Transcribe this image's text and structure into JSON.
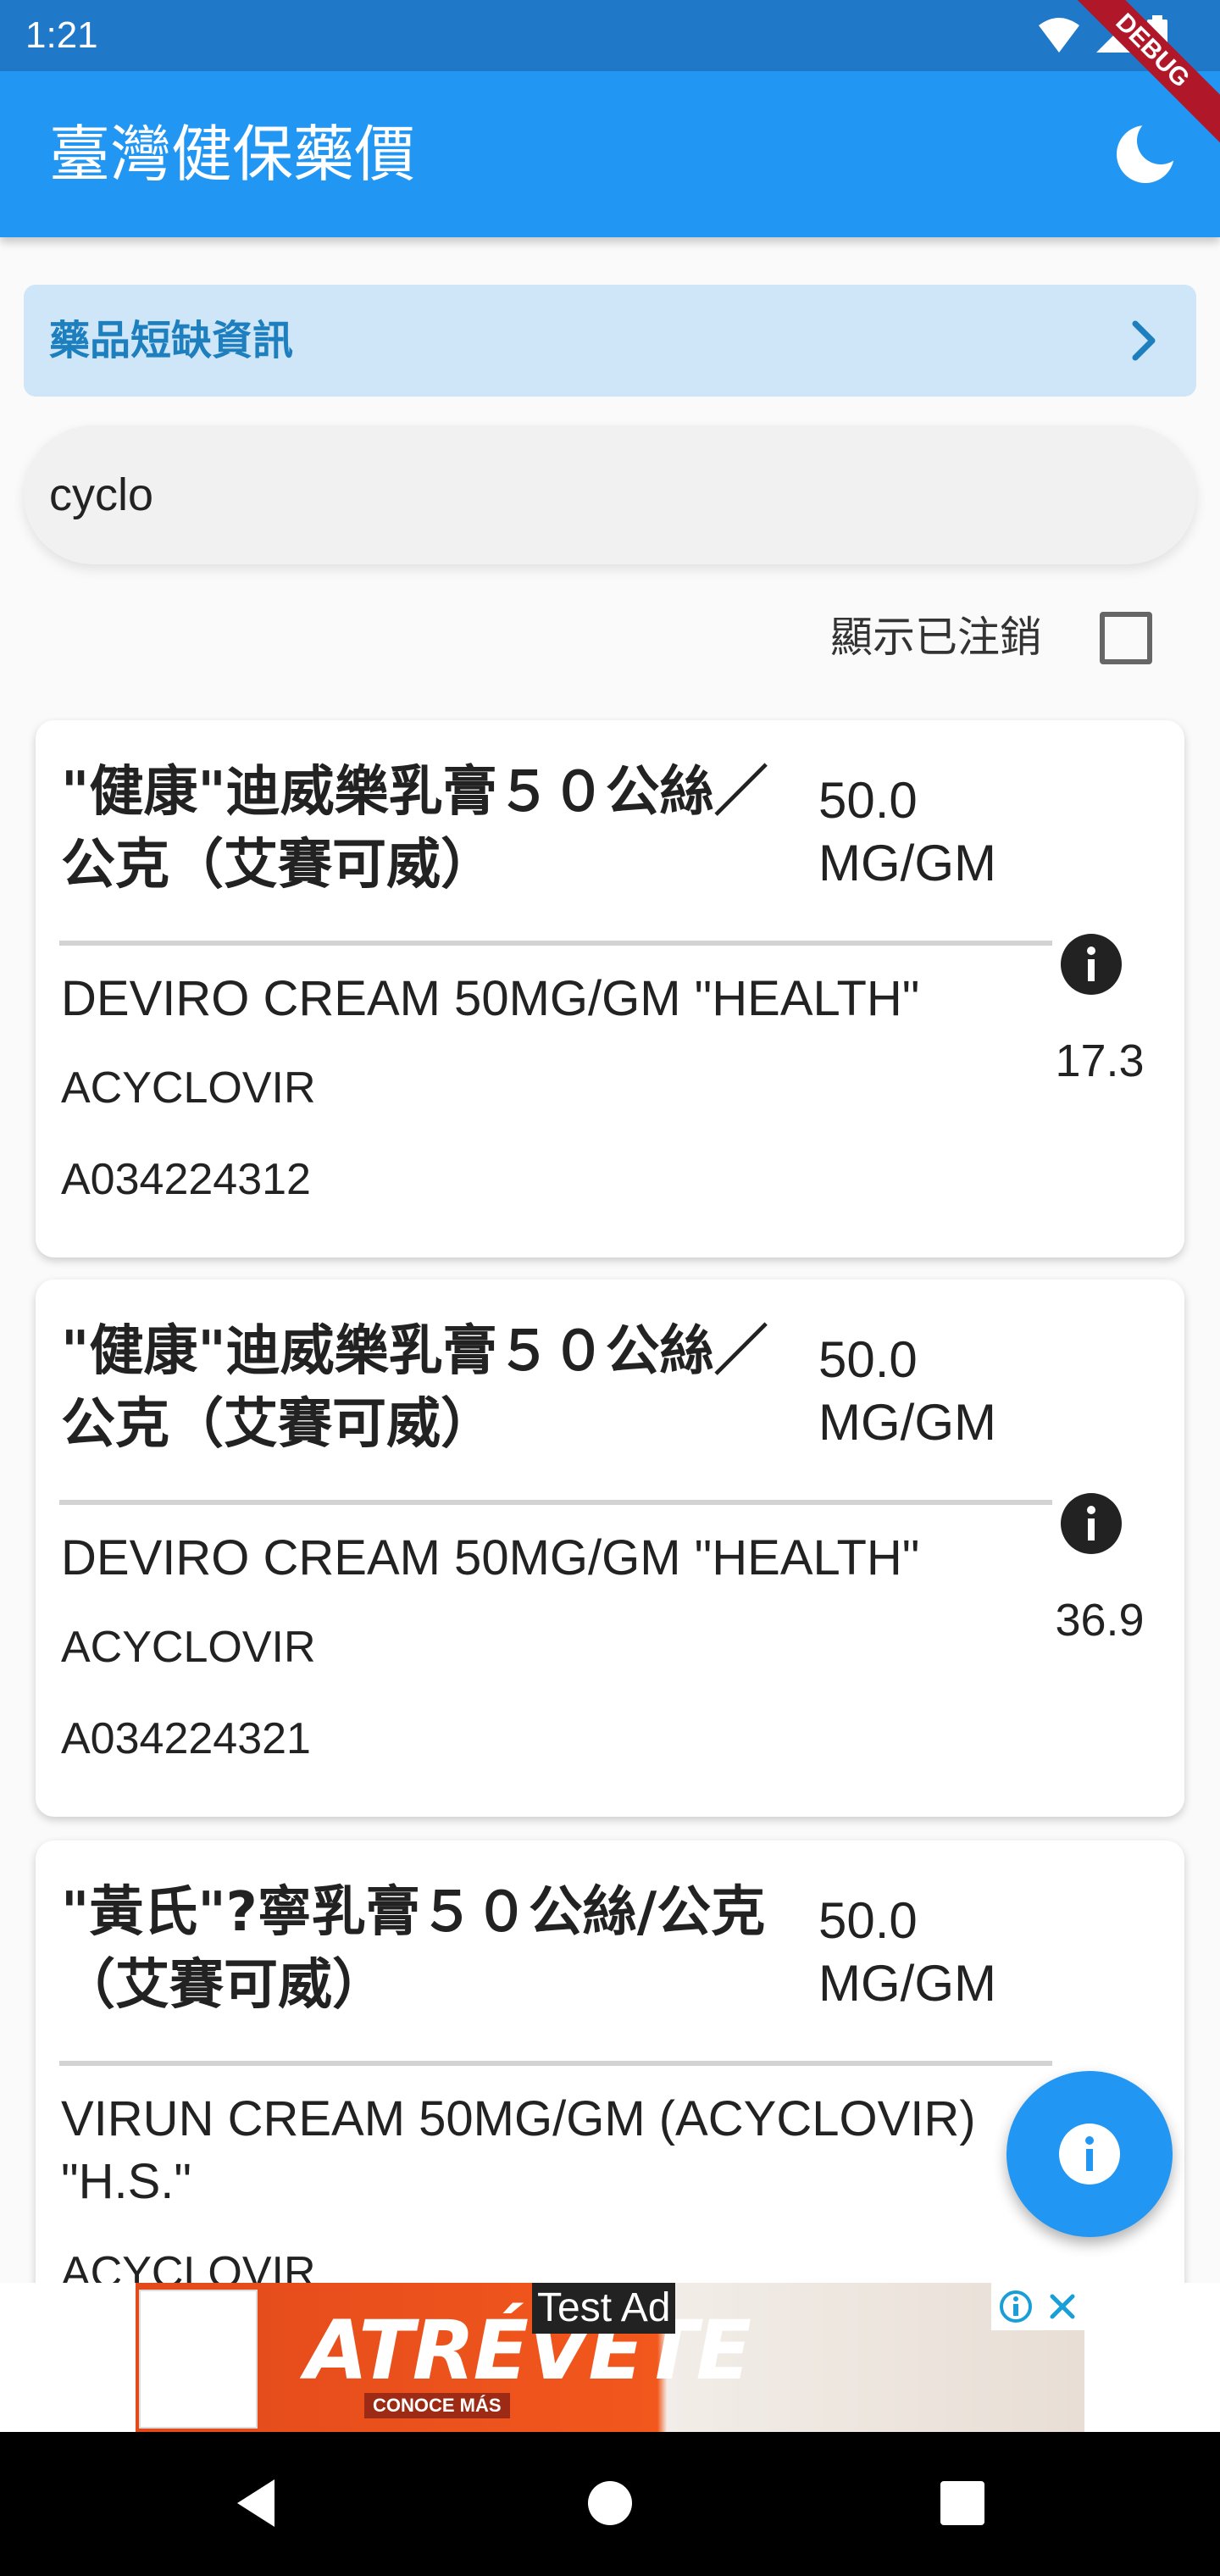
{
  "status_bar": {
    "time": "1:21",
    "debug_label": "DEBUG"
  },
  "app_bar": {
    "title": "臺灣健保藥價",
    "theme_icon": "moon-icon"
  },
  "shortage_banner": {
    "label": "藥品短缺資訊",
    "icon": "chevron-right-icon"
  },
  "search": {
    "value": "cyclo",
    "placeholder": ""
  },
  "filters": {
    "show_cancelled_label": "顯示已注銷",
    "show_cancelled_checked": false
  },
  "results": [
    {
      "name": "\"健康\"迪威樂乳膏５０公絲／公克（艾賽可威）",
      "dose": "50.0 MG/GM",
      "english": "DEVIRO CREAM 50MG/GM \"HEALTH\"",
      "ingredient": "ACYCLOVIR",
      "code": "A034224312",
      "price": "17.3"
    },
    {
      "name": "\"健康\"迪威樂乳膏５０公絲／公克（艾賽可威）",
      "dose": "50.0 MG/GM",
      "english": "DEVIRO CREAM 50MG/GM \"HEALTH\"",
      "ingredient": "ACYCLOVIR",
      "code": "A034224321",
      "price": "36.9"
    },
    {
      "name": "\"黃氏\"?寧乳膏５０公絲/公克（艾賽可威）",
      "dose": "50.0 MG/GM",
      "english": "VIRUN CREAM 50MG/GM (ACYCLOVIR) \"H.S.\"",
      "ingredient": "ACYCLOVIR",
      "code": "",
      "price": ""
    }
  ],
  "fab": {
    "icon": "info-icon"
  },
  "ad": {
    "label": "Test Ad",
    "brand_text": "ATRÉVETE",
    "sub_text": "CONOCE MÁS"
  },
  "colors": {
    "app_bar": "#2196f3",
    "status_bar": "#1f78c8",
    "banner_bg": "#cfe6f8",
    "banner_text": "#1d7fbe"
  }
}
